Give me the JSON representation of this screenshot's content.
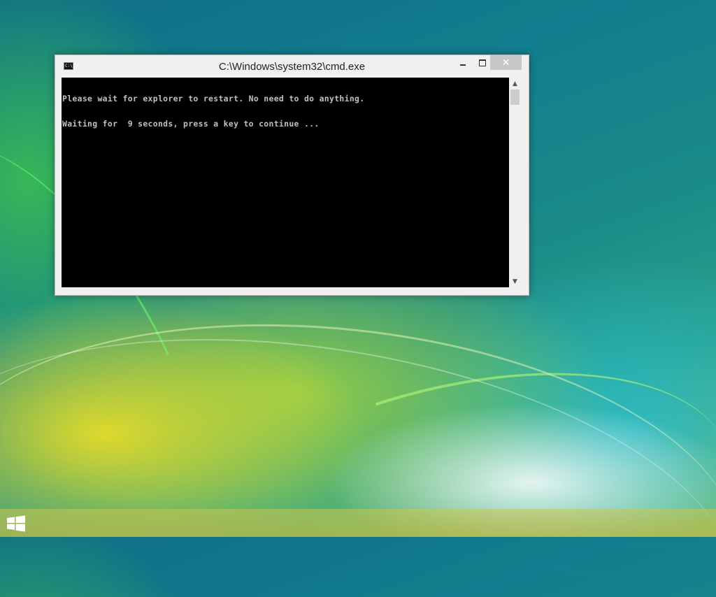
{
  "window": {
    "title": "C:\\Windows\\system32\\cmd.exe",
    "app_icon_text": "C:\\",
    "controls": {
      "minimize": "minimize",
      "maximize": "maximize",
      "close": "✕"
    }
  },
  "console": {
    "lines": [
      "Please wait for explorer to restart. No need to do anything.",
      "Waiting for  9 seconds, press a key to continue ..."
    ],
    "background": "#000000",
    "text_color": "#c0c0c0"
  },
  "scrollbar": {
    "up_arrow": "▲",
    "down_arrow": "▼"
  },
  "taskbar": {
    "start_icon": "windows-logo-icon"
  }
}
